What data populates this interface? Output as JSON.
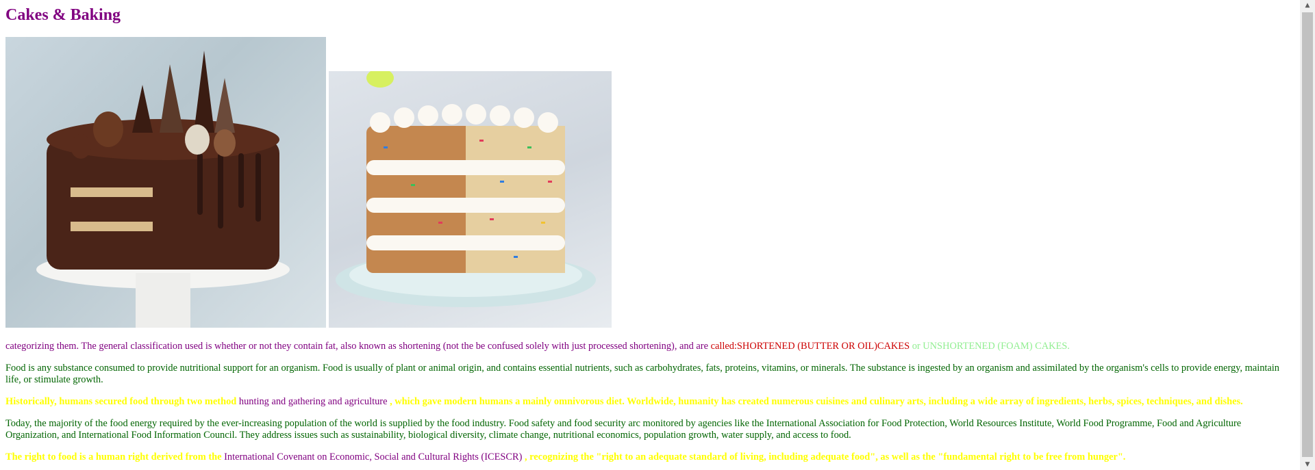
{
  "page": {
    "title": "Cakes & Baking"
  },
  "images": [
    {
      "name": "chocolate-cake-image"
    },
    {
      "name": "funfetti-cake-image"
    }
  ],
  "paragraphs": {
    "p1": {
      "text_a": "categorizing them. The general classification used is whether or not they contain fat, also known as shortening (not the be confused solely with just processed shortening), and are ",
      "text_red": "called:SHORTENED (BUTTER OR OIL)CAKES",
      "text_green": " or UNSHORTENED (FOAM) CAKES."
    },
    "p2": {
      "text": "Food is any substance consumed to provide nutritional support for an organism. Food is usually of plant or animal origin, and contains essential nutrients, such as carbohydrates, fats, proteins, vitamins, or minerals. The substance is ingested by an organism and assimilated by the organism's cells to provide energy, maintain life, or stimulate growth."
    },
    "p3": {
      "text_a": "Historically, humans secured food through two method ",
      "text_purple": "hunting and gathering and agriculture",
      "text_b": " , which gave modern humans a mainly omnivorous diet. Worldwide, humanity has created numerous cuisines and culinary arts, including a wide array of ingredients, herbs, spices, techniques, and dishes."
    },
    "p4": {
      "text": "Today, the majority of the food energy required by the ever-increasing population of the world is supplied by the food industry. Food safety and food security arc monitored by agencies like the International Association for Food Protection, World Resources Institute, World Food Programme, Food and Agriculture Organization, and International Food Information Council. They address issues such as sustainability, biological diversity, climate change, nutritional economics, population growth, water supply, and access to food."
    },
    "p5": {
      "text_a": "The right to food is a human right derived from the ",
      "text_purple": "International Covenant on Economic, Social and Cultural Rights (ICESCR)",
      "text_b": " , recognizing the \"right to an adequate standard of living, including adequate food\", as well as the \"fundamental right to be free from hunger\"."
    }
  },
  "colors": {
    "title": "#800080",
    "purple_text": "#800080",
    "green_text": "#006400",
    "yellow_text": "#ffff00",
    "red_text": "#cc0000",
    "light_green_text": "#90ee90"
  },
  "scrollbar": {
    "up_icon": "triangle-up-icon",
    "down_icon": "triangle-down-icon"
  }
}
